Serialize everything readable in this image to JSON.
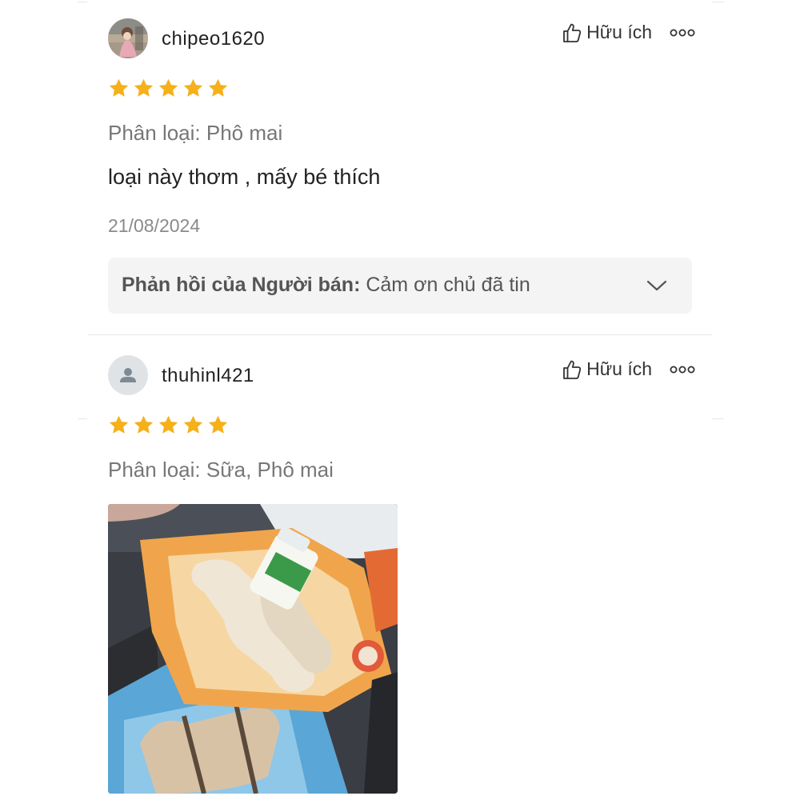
{
  "reviews": [
    {
      "username": "chipeo1620",
      "avatar": "photo-avatar",
      "helpful_label": "Hữu ích",
      "rating": 5,
      "variant": "Phân loại: Phô mai",
      "comment": "loại này thơm , mấy bé thích",
      "date": "21/08/2024",
      "seller_reply": {
        "label": "Phản hồi của Người bán:",
        "text": "Cảm ơn chủ đã tin"
      }
    },
    {
      "username": "thuhinl421",
      "avatar": "default-user-icon",
      "helpful_label": "Hữu ích",
      "rating": 5,
      "variant": "Phân loại: Sữa, Phô mai",
      "photo": "product-photo"
    }
  ],
  "colors": {
    "star": "#f6b01a",
    "divider": "#e6e6e6",
    "reply_background": "#f4f4f4",
    "muted_text": "#777777"
  },
  "icons": [
    "thumbs-up-icon",
    "more-options-icon",
    "star-icon",
    "chevron-down-icon",
    "user-icon"
  ]
}
